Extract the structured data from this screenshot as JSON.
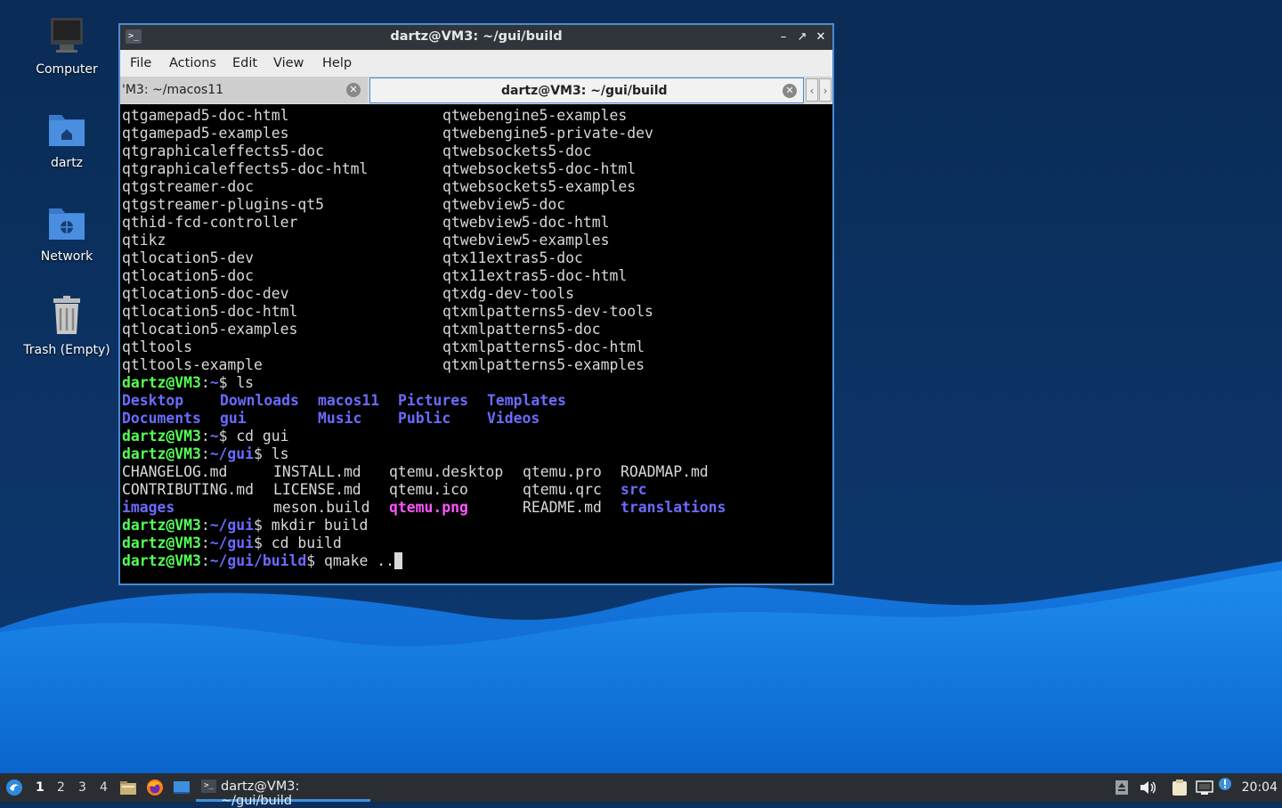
{
  "desktop": {
    "icons": [
      {
        "label": "Computer",
        "icon": "computer-icon"
      },
      {
        "label": "dartz",
        "icon": "home-folder-icon"
      },
      {
        "label": "Network",
        "icon": "network-folder-icon"
      },
      {
        "label": "Trash (Empty)",
        "icon": "trash-icon"
      }
    ]
  },
  "window": {
    "title": "dartz@VM3: ~/gui/build",
    "controls": [
      "minimize-icon",
      "restore-icon",
      "close-icon"
    ],
    "menu": [
      "File",
      "Actions",
      "Edit",
      "View",
      "Help"
    ],
    "tabs": [
      {
        "label": "'M3: ~/macos11",
        "active": false
      },
      {
        "label": "dartz@VM3: ~/gui/build",
        "active": true
      }
    ]
  },
  "terminal": {
    "two_col_list": [
      [
        "qtgamepad5-doc-html",
        "qtwebengine5-examples"
      ],
      [
        "qtgamepad5-examples",
        "qtwebengine5-private-dev"
      ],
      [
        "qtgraphicaleffects5-doc",
        "qtwebsockets5-doc"
      ],
      [
        "qtgraphicaleffects5-doc-html",
        "qtwebsockets5-doc-html"
      ],
      [
        "qtgstreamer-doc",
        "qtwebsockets5-examples"
      ],
      [
        "qtgstreamer-plugins-qt5",
        "qtwebview5-doc"
      ],
      [
        "qthid-fcd-controller",
        "qtwebview5-doc-html"
      ],
      [
        "qtikz",
        "qtwebview5-examples"
      ],
      [
        "qtlocation5-dev",
        "qtx11extras5-doc"
      ],
      [
        "qtlocation5-doc",
        "qtx11extras5-doc-html"
      ],
      [
        "qtlocation5-doc-dev",
        "qtxdg-dev-tools"
      ],
      [
        "qtlocation5-doc-html",
        "qtxmlpatterns5-dev-tools"
      ],
      [
        "qtlocation5-examples",
        "qtxmlpatterns5-doc"
      ],
      [
        "qtltools",
        "qtxmlpatterns5-doc-html"
      ],
      [
        "qtltools-example",
        "qtxmlpatterns5-examples"
      ]
    ],
    "prompt_user": "dartz@VM3",
    "sessions": {
      "ls_home": {
        "path": "~",
        "cmd": "ls"
      },
      "cd_gui": {
        "path": "~",
        "cmd": "cd gui"
      },
      "ls_gui": {
        "path": "~/gui",
        "cmd": "ls"
      },
      "mkdir": {
        "path": "~/gui",
        "cmd": "mkdir build"
      },
      "cd_build": {
        "path": "~/gui",
        "cmd": "cd build"
      },
      "qmake": {
        "path": "~/gui/build",
        "cmd": "qmake .."
      }
    },
    "home_ls": [
      [
        "Desktop",
        "Downloads",
        "macos11",
        "Pictures",
        "Templates"
      ],
      [
        "Documents",
        "gui",
        "Music",
        "Public",
        "Videos"
      ]
    ],
    "gui_ls": [
      [
        "CHANGELOG.md",
        "INSTALL.md",
        "qtemu.desktop",
        "qtemu.pro",
        "ROADMAP.md"
      ],
      [
        "CONTRIBUTING.md",
        "LICENSE.md",
        "qtemu.ico",
        "qtemu.qrc",
        "src"
      ],
      [
        "images",
        "meson.build",
        "qtemu.png",
        "README.md",
        "translations"
      ]
    ]
  },
  "taskbar": {
    "workspaces": [
      "1",
      "2",
      "3",
      "4"
    ],
    "task_label": "dartz@VM3: ~/gui/build",
    "clock": "20:04",
    "tray_icons": [
      "eject-icon",
      "volume-icon",
      "clipboard-icon",
      "network-icon",
      "notification-icon"
    ]
  },
  "colors": {
    "prompt_user": "#55ff55",
    "prompt_path": "#6b6bff",
    "directory": "#6b6bff",
    "image_file": "#ff55ff",
    "accent": "#3e8ede"
  }
}
